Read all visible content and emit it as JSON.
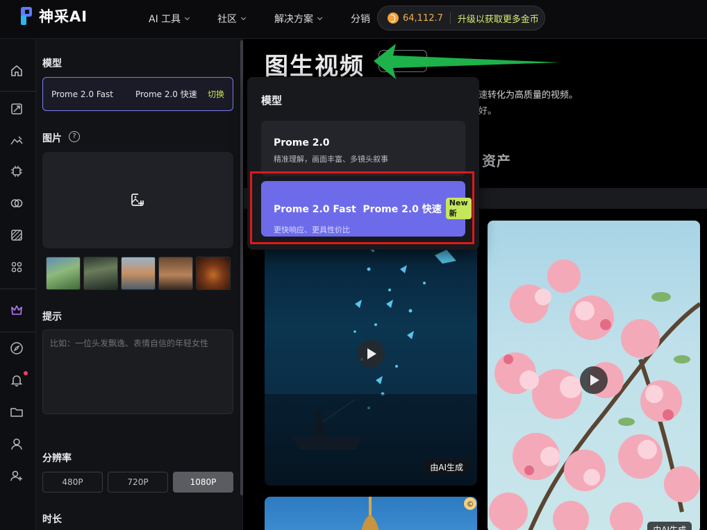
{
  "brand": {
    "name": "神采AI"
  },
  "nav": {
    "items": [
      {
        "label": "AI 工具",
        "dropdown": true
      },
      {
        "label": "社区",
        "dropdown": true
      },
      {
        "label": "解决方案",
        "dropdown": true
      },
      {
        "label": "分销",
        "dropdown": false
      }
    ],
    "coins": "64,112.7",
    "upgrade_cta": "升级以获取更多金币"
  },
  "panel": {
    "model_title": "模型",
    "model_selected": {
      "name": "Prome 2.0 Fast",
      "alias": "Prome 2.0 快速",
      "switch_label": "切换"
    },
    "image_title": "图片",
    "help": "?",
    "prompt_title": "提示",
    "prompt_placeholder": "比如：一位头发飘逸、表情自信的年轻女性",
    "resolution_title": "分辨率",
    "resolutions": [
      "480P",
      "720P",
      "1080P"
    ],
    "resolution_selected": "1080P",
    "duration_title": "时长"
  },
  "main": {
    "title": "图生视频",
    "desc_line1": "速转化为高质量的视频。",
    "desc_line2": "好。",
    "assets_tab": "资产",
    "ai_badge": "由AI生成"
  },
  "dropdown": {
    "title": "模型",
    "options": [
      {
        "name": "Prome 2.0",
        "desc": "精准理解，画面丰富、多镜头叙事"
      },
      {
        "name": "Prome 2.0 Fast  Prome 2.0 快速",
        "badge": "New 新",
        "desc": "更快响应、更具性价比"
      }
    ]
  },
  "colors": {
    "accent": "#6d6bea",
    "highlight": "#e01818",
    "arrow": "#1db24a",
    "switch": "#c8e35a"
  }
}
